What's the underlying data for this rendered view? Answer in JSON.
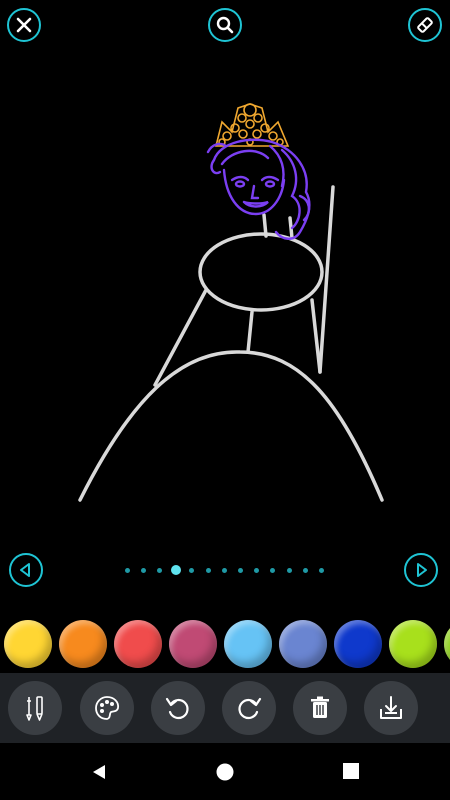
{
  "header": {
    "close_icon": "close-icon",
    "search_icon": "search-icon",
    "eraser_icon": "eraser-icon",
    "accent_color": "#1fc4d4"
  },
  "pager": {
    "total_pages": 13,
    "current_page": 4,
    "prev_icon": "triangle-left-icon",
    "next_icon": "triangle-right-icon"
  },
  "palette": {
    "colors": [
      "#ffd633",
      "#f78a1e",
      "#f04c4c",
      "#c04a74",
      "#66c3f5",
      "#6a85d1",
      "#0f39cc",
      "#a8e01c",
      "#8fd11a"
    ]
  },
  "toolbar": {
    "tools": [
      "brush-pen-icon",
      "paint-palette-icon",
      "undo-icon",
      "redo-icon",
      "delete-icon",
      "save-download-icon"
    ],
    "background": "#1f2226",
    "button_color": "#3a3e43"
  },
  "navbar": {
    "back_icon": "back-triangle-icon",
    "home_icon": "home-circle-icon",
    "recents_icon": "recents-square-icon"
  },
  "drawing": {
    "stroke_color": "#d9d9d9",
    "hair_color": "#7b3ff2",
    "crown_color": "#f0a830"
  }
}
